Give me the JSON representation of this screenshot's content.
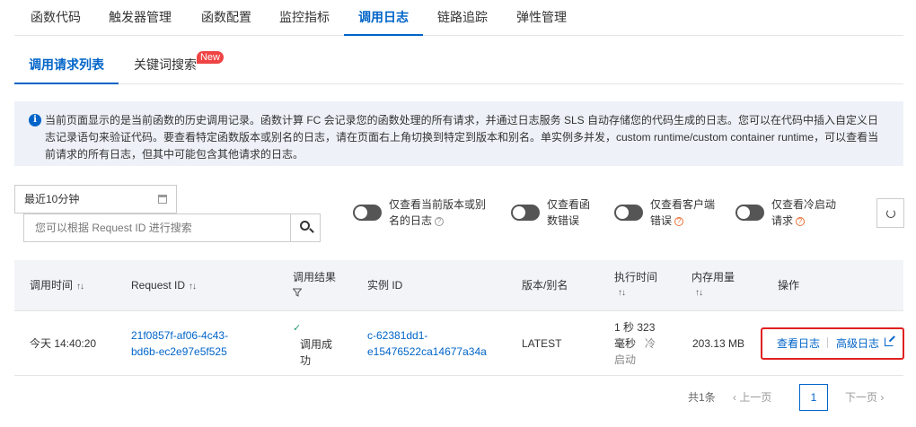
{
  "top_tabs": [
    "函数代码",
    "触发器管理",
    "函数配置",
    "监控指标",
    "调用日志",
    "链路追踪",
    "弹性管理"
  ],
  "active_top_tab": "调用日志",
  "sub_tabs": {
    "list": "调用请求列表",
    "keyword": "关键词搜索",
    "new_badge": "New"
  },
  "info": {
    "text": "当前页面显示的是当前函数的历史调用记录。函数计算 FC 会记录您的函数处理的所有请求，并通过日志服务 SLS 自动存储您的代码生成的日志。您可以在代码中插入自定义日志记录语句来验证代码。要查看特定函数版本或别名的日志，请在页面右上角切换到特定到版本和别名。单实例多并发，custom runtime/custom container runtime，可以查看当前请求的所有日志，但其中可能包含其他请求的日志。"
  },
  "filters": {
    "time_range": "最近10分钟",
    "search_placeholder": "您可以根据 Request ID 进行搜索",
    "toggle1_l1": "仅查看当前版本或别",
    "toggle1_l2": "名的日志",
    "toggle2_l1": "仅查看函",
    "toggle2_l2": "数错误",
    "toggle3_l1": "仅查看客户端",
    "toggle3_l2": "错误",
    "toggle4_l1": "仅查看冷启动",
    "toggle4_l2": "请求",
    "toggle_state": "off"
  },
  "table": {
    "headers": {
      "time": "调用时间",
      "request_id": "Request ID",
      "result": "调用结果",
      "instance": "实例 ID",
      "version": "版本/别名",
      "exec_l1": "执行时间",
      "memory": "内存用量",
      "ops": "操作"
    },
    "row": {
      "time": "今天 14:40:20",
      "request_id_l1": "21f0857f-af06-4c43-",
      "request_id_l2": "bd6b-ec2e97e5f525",
      "result_l1": "调用成",
      "result_l2": "功",
      "instance_l1": "c-62381dd1-",
      "instance_l2": "e15476522ca14677a34a",
      "version": "LATEST",
      "exec_l1": "1 秒 323",
      "exec_l2a": "毫秒",
      "exec_l2b": "冷",
      "exec_l3": "启动",
      "memory": "203.13 MB",
      "view_log": "查看日志",
      "advanced_log": "高级日志"
    }
  },
  "pagination": {
    "total": "共1条",
    "prev": "上一页",
    "page": "1",
    "next": "下一页"
  },
  "colors": {
    "accent": "#0064c8",
    "highlight": "#e02020",
    "success": "#22a06b"
  }
}
